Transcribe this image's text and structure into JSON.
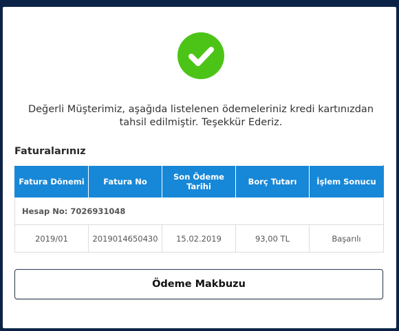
{
  "message": "Değerli Müşterimiz, aşağıda listelenen ödemeleriniz kredi kartınızdan tahsil edilmiştir. Teşekkür Ederiz.",
  "section_title": "Faturalarınız",
  "table": {
    "headers": [
      "Fatura Dönemi",
      "Fatura No",
      "Son Ödeme Tarihi",
      "Borç Tutarı",
      "İşlem Sonucu"
    ],
    "account_label": "Hesap No: 7026931048",
    "rows": [
      [
        "2019/01",
        "2019014650430",
        "15.02.2019",
        "93,00 TL",
        "Başarılı"
      ]
    ]
  },
  "receipt_button": "Ödeme Makbuzu",
  "icons": {
    "success": "check-circle-icon"
  },
  "colors": {
    "success": "#4cc417",
    "header": "#1787d7",
    "frame": "#0b2346"
  }
}
